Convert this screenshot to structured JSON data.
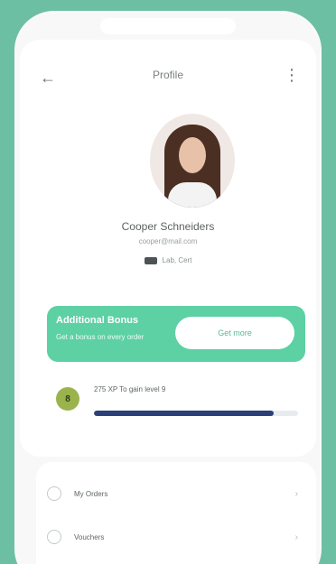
{
  "header": {
    "title": "Profile",
    "back_icon": "back-arrow-icon",
    "more_icon": "more-vertical-icon"
  },
  "profile": {
    "name": "Cooper Schneiders",
    "email": "cooper@mail.com",
    "location": "Lab, Cert",
    "location_icon": "id-card-icon"
  },
  "banner": {
    "title": "Additional Bonus",
    "subtitle": "Get a bonus on every order",
    "button_label": "Get more",
    "color": "#5dd0a4"
  },
  "progress": {
    "badge": "8",
    "text": "275 XP To gain level 9",
    "percent": 88,
    "fill_color": "#2c3f78"
  },
  "menu": {
    "items": [
      {
        "label": "My Orders",
        "icon": "orders-icon"
      },
      {
        "label": "Vouchers",
        "icon": "voucher-icon"
      }
    ]
  },
  "colors": {
    "background": "#6dbfa4",
    "accent": "#5dd0a4"
  }
}
